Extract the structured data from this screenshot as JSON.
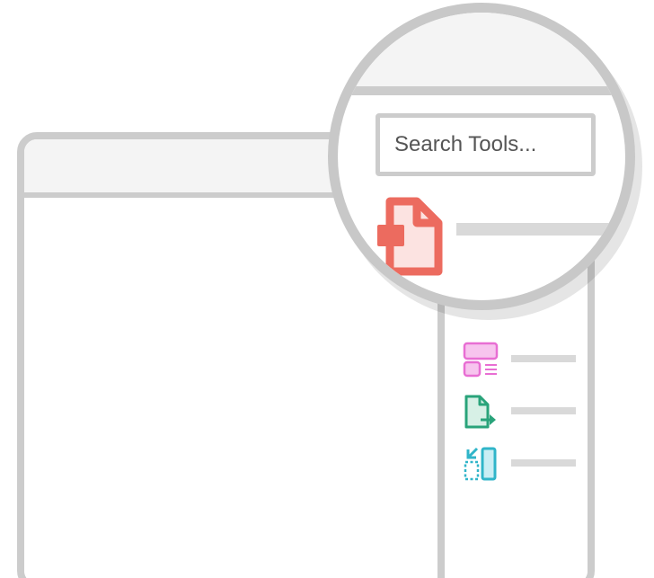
{
  "search": {
    "placeholder": "Search Tools..."
  },
  "magnified_tool": {
    "icon": "pdf-document-icon",
    "color": "#ec6b5f"
  },
  "tools": [
    {
      "icon": "organize-pages-icon",
      "color": "#e86ed3"
    },
    {
      "icon": "export-pdf-icon",
      "color": "#29a37a"
    },
    {
      "icon": "compare-files-icon",
      "color": "#30b5c9"
    }
  ],
  "colors": {
    "frame": "#cccccc",
    "header": "#f4f4f4",
    "placeholder_bar": "#d9d9d9",
    "search_text": "#555555"
  }
}
